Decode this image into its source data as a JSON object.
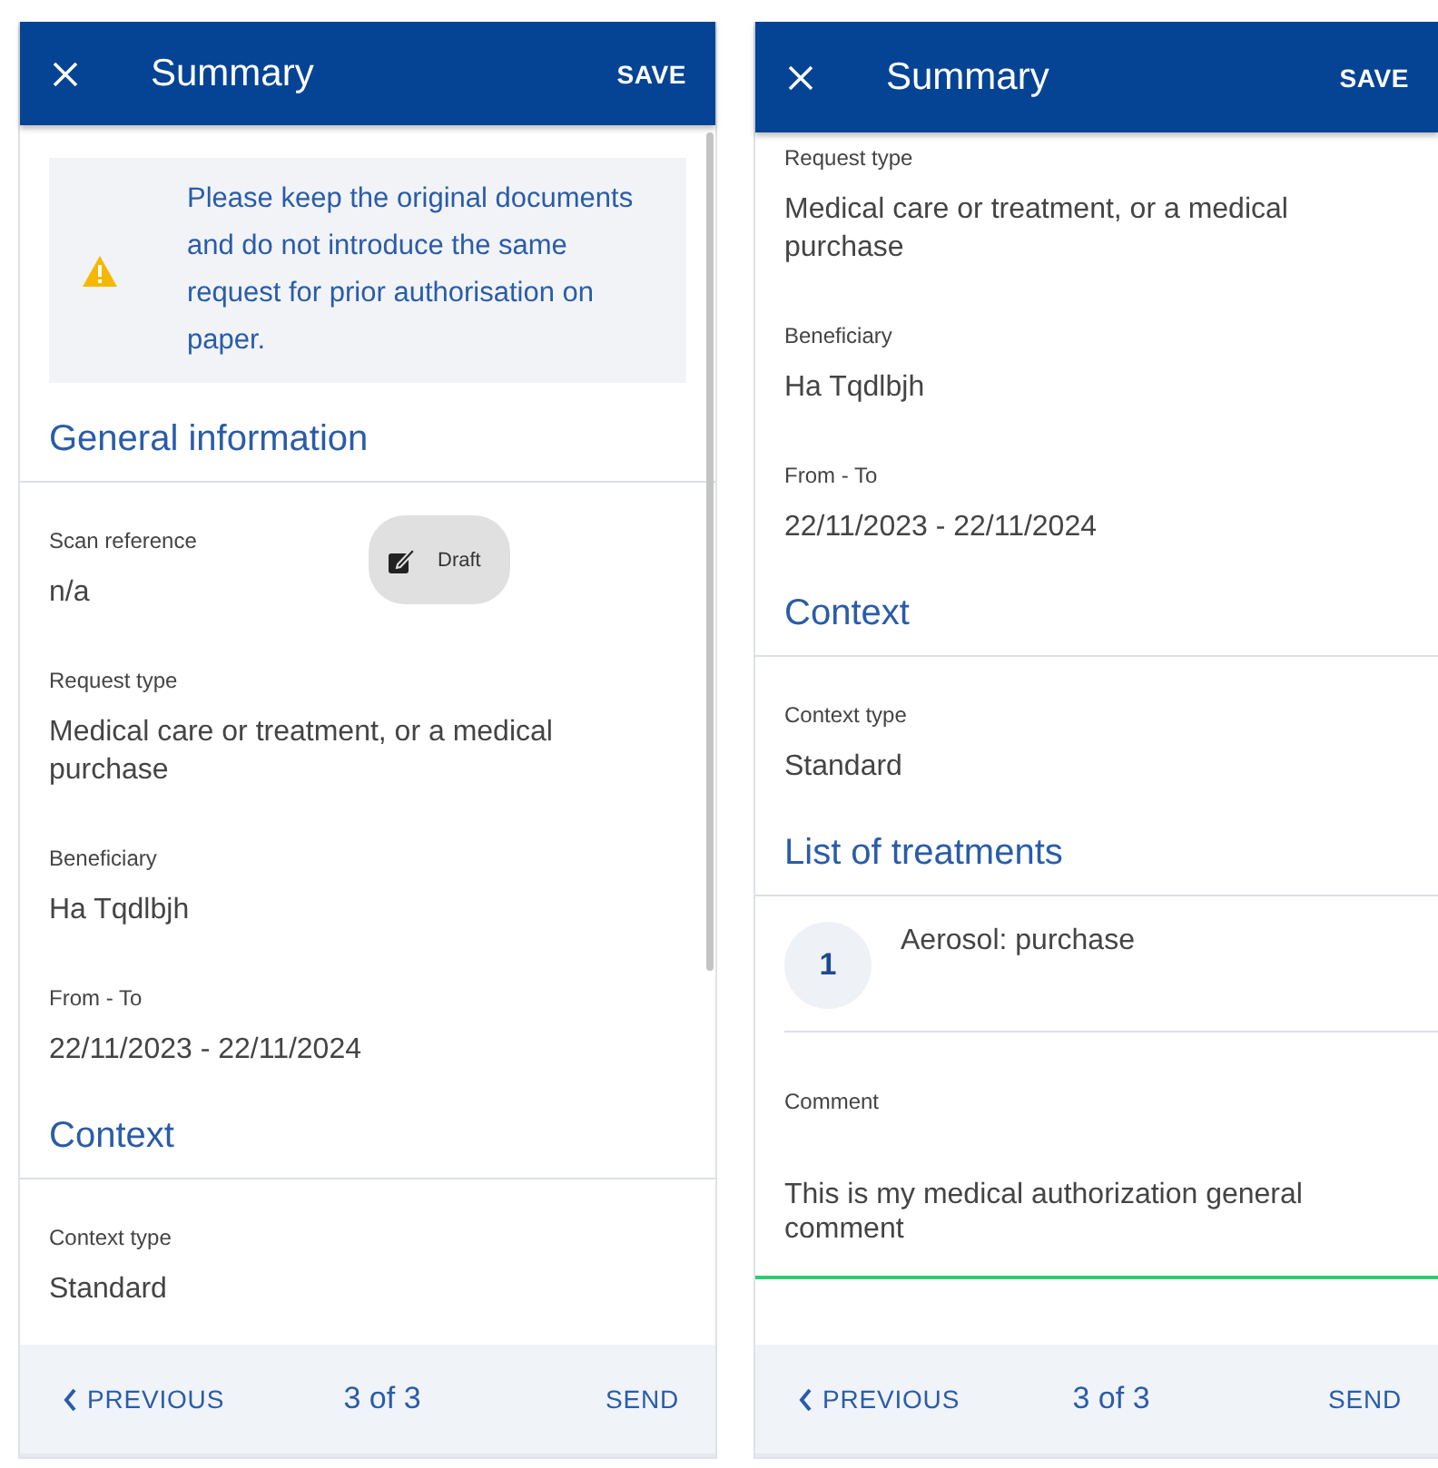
{
  "screens": [
    {
      "header": {
        "title": "Summary",
        "action": "SAVE"
      },
      "content": [
        {
          "kind": "notice",
          "text": "Please keep the original documents and do not introduce the same request for prior authorisation on paper."
        },
        {
          "kind": "section",
          "title": "General information"
        },
        {
          "kind": "field",
          "label": "Scan reference",
          "value": "n/a",
          "badge": "Draft"
        },
        {
          "kind": "field",
          "label": "Request type",
          "value": "Medical care or treatment, or a medical purchase"
        },
        {
          "kind": "field",
          "label": "Beneficiary",
          "value": "Ha Tqdlbjh"
        },
        {
          "kind": "field",
          "label": "From - To",
          "value": "22/11/2023 - 22/11/2024"
        },
        {
          "kind": "section",
          "title": "Context"
        },
        {
          "kind": "field",
          "label": "Context type",
          "value": "Standard"
        }
      ],
      "footer": {
        "previous": "PREVIOUS",
        "page": "3 of 3",
        "send": "SEND"
      }
    },
    {
      "header": {
        "title": "Summary",
        "action": "SAVE"
      },
      "content": [
        {
          "kind": "field",
          "label": "Request type",
          "value": "Medical care or treatment, or a medical purchase"
        },
        {
          "kind": "field",
          "label": "Beneficiary",
          "value": "Ha Tqdlbjh"
        },
        {
          "kind": "field",
          "label": "From - To",
          "value": "22/11/2023 - 22/11/2024"
        },
        {
          "kind": "section",
          "title": "Context"
        },
        {
          "kind": "field",
          "label": "Context type",
          "value": "Standard"
        },
        {
          "kind": "section",
          "title": "List of treatments"
        },
        {
          "kind": "treatment",
          "number": "1",
          "text": "Aerosol: purchase"
        },
        {
          "kind": "comment",
          "label": "Comment",
          "value": "This is my medical authorization general comment",
          "focused": true
        }
      ],
      "footer": {
        "previous": "PREVIOUS",
        "page": "3 of 3",
        "send": "SEND"
      }
    }
  ]
}
